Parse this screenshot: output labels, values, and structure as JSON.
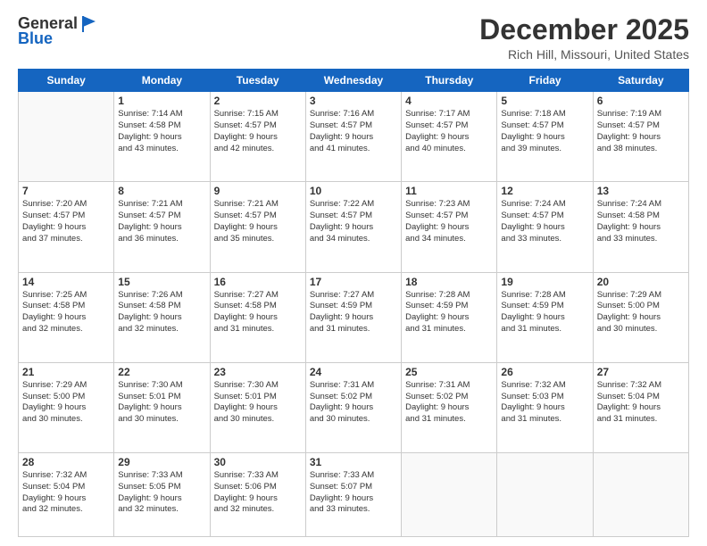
{
  "header": {
    "logo_general": "General",
    "logo_blue": "Blue",
    "month_title": "December 2025",
    "location": "Rich Hill, Missouri, United States"
  },
  "weekdays": [
    "Sunday",
    "Monday",
    "Tuesday",
    "Wednesday",
    "Thursday",
    "Friday",
    "Saturday"
  ],
  "weeks": [
    [
      {
        "day": "",
        "info": ""
      },
      {
        "day": "1",
        "info": "Sunrise: 7:14 AM\nSunset: 4:58 PM\nDaylight: 9 hours\nand 43 minutes."
      },
      {
        "day": "2",
        "info": "Sunrise: 7:15 AM\nSunset: 4:57 PM\nDaylight: 9 hours\nand 42 minutes."
      },
      {
        "day": "3",
        "info": "Sunrise: 7:16 AM\nSunset: 4:57 PM\nDaylight: 9 hours\nand 41 minutes."
      },
      {
        "day": "4",
        "info": "Sunrise: 7:17 AM\nSunset: 4:57 PM\nDaylight: 9 hours\nand 40 minutes."
      },
      {
        "day": "5",
        "info": "Sunrise: 7:18 AM\nSunset: 4:57 PM\nDaylight: 9 hours\nand 39 minutes."
      },
      {
        "day": "6",
        "info": "Sunrise: 7:19 AM\nSunset: 4:57 PM\nDaylight: 9 hours\nand 38 minutes."
      }
    ],
    [
      {
        "day": "7",
        "info": "Sunrise: 7:20 AM\nSunset: 4:57 PM\nDaylight: 9 hours\nand 37 minutes."
      },
      {
        "day": "8",
        "info": "Sunrise: 7:21 AM\nSunset: 4:57 PM\nDaylight: 9 hours\nand 36 minutes."
      },
      {
        "day": "9",
        "info": "Sunrise: 7:21 AM\nSunset: 4:57 PM\nDaylight: 9 hours\nand 35 minutes."
      },
      {
        "day": "10",
        "info": "Sunrise: 7:22 AM\nSunset: 4:57 PM\nDaylight: 9 hours\nand 34 minutes."
      },
      {
        "day": "11",
        "info": "Sunrise: 7:23 AM\nSunset: 4:57 PM\nDaylight: 9 hours\nand 34 minutes."
      },
      {
        "day": "12",
        "info": "Sunrise: 7:24 AM\nSunset: 4:57 PM\nDaylight: 9 hours\nand 33 minutes."
      },
      {
        "day": "13",
        "info": "Sunrise: 7:24 AM\nSunset: 4:58 PM\nDaylight: 9 hours\nand 33 minutes."
      }
    ],
    [
      {
        "day": "14",
        "info": "Sunrise: 7:25 AM\nSunset: 4:58 PM\nDaylight: 9 hours\nand 32 minutes."
      },
      {
        "day": "15",
        "info": "Sunrise: 7:26 AM\nSunset: 4:58 PM\nDaylight: 9 hours\nand 32 minutes."
      },
      {
        "day": "16",
        "info": "Sunrise: 7:27 AM\nSunset: 4:58 PM\nDaylight: 9 hours\nand 31 minutes."
      },
      {
        "day": "17",
        "info": "Sunrise: 7:27 AM\nSunset: 4:59 PM\nDaylight: 9 hours\nand 31 minutes."
      },
      {
        "day": "18",
        "info": "Sunrise: 7:28 AM\nSunset: 4:59 PM\nDaylight: 9 hours\nand 31 minutes."
      },
      {
        "day": "19",
        "info": "Sunrise: 7:28 AM\nSunset: 4:59 PM\nDaylight: 9 hours\nand 31 minutes."
      },
      {
        "day": "20",
        "info": "Sunrise: 7:29 AM\nSunset: 5:00 PM\nDaylight: 9 hours\nand 30 minutes."
      }
    ],
    [
      {
        "day": "21",
        "info": "Sunrise: 7:29 AM\nSunset: 5:00 PM\nDaylight: 9 hours\nand 30 minutes."
      },
      {
        "day": "22",
        "info": "Sunrise: 7:30 AM\nSunset: 5:01 PM\nDaylight: 9 hours\nand 30 minutes."
      },
      {
        "day": "23",
        "info": "Sunrise: 7:30 AM\nSunset: 5:01 PM\nDaylight: 9 hours\nand 30 minutes."
      },
      {
        "day": "24",
        "info": "Sunrise: 7:31 AM\nSunset: 5:02 PM\nDaylight: 9 hours\nand 30 minutes."
      },
      {
        "day": "25",
        "info": "Sunrise: 7:31 AM\nSunset: 5:02 PM\nDaylight: 9 hours\nand 31 minutes."
      },
      {
        "day": "26",
        "info": "Sunrise: 7:32 AM\nSunset: 5:03 PM\nDaylight: 9 hours\nand 31 minutes."
      },
      {
        "day": "27",
        "info": "Sunrise: 7:32 AM\nSunset: 5:04 PM\nDaylight: 9 hours\nand 31 minutes."
      }
    ],
    [
      {
        "day": "28",
        "info": "Sunrise: 7:32 AM\nSunset: 5:04 PM\nDaylight: 9 hours\nand 32 minutes."
      },
      {
        "day": "29",
        "info": "Sunrise: 7:33 AM\nSunset: 5:05 PM\nDaylight: 9 hours\nand 32 minutes."
      },
      {
        "day": "30",
        "info": "Sunrise: 7:33 AM\nSunset: 5:06 PM\nDaylight: 9 hours\nand 32 minutes."
      },
      {
        "day": "31",
        "info": "Sunrise: 7:33 AM\nSunset: 5:07 PM\nDaylight: 9 hours\nand 33 minutes."
      },
      {
        "day": "",
        "info": ""
      },
      {
        "day": "",
        "info": ""
      },
      {
        "day": "",
        "info": ""
      }
    ]
  ]
}
